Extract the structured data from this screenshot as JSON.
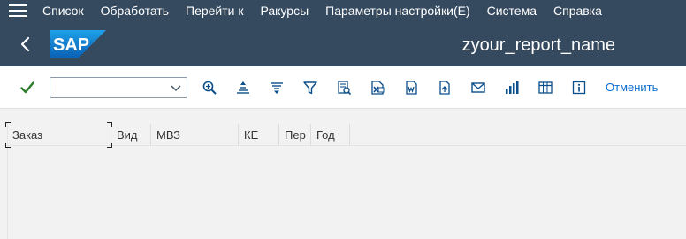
{
  "menubar": {
    "items": [
      {
        "label": "Список"
      },
      {
        "label": "Обработать"
      },
      {
        "label": "Перейти к"
      },
      {
        "label": "Ракурсы"
      },
      {
        "label": "Параметры настройки(E)"
      },
      {
        "label": "Система"
      },
      {
        "label": "Справка"
      }
    ]
  },
  "header": {
    "title": "zyour_report_name",
    "logo_text": "SAP",
    "logo_color": "#1a7fd1"
  },
  "toolbar": {
    "command_field": {
      "value": "",
      "placeholder": ""
    },
    "icons": [
      "find-icon",
      "sort-ascending-icon",
      "sort-descending-icon",
      "filter-icon",
      "details-icon",
      "spreadsheet-icon",
      "word-processing-icon",
      "local-file-icon",
      "email-icon",
      "graphic-icon",
      "change-layout-icon",
      "info-icon"
    ],
    "cancel_label": "Отменить"
  },
  "table": {
    "columns": [
      {
        "label": "Заказ"
      },
      {
        "label": "Вид"
      },
      {
        "label": "МВЗ"
      },
      {
        "label": "КЕ"
      },
      {
        "label": "Пер"
      },
      {
        "label": "Год"
      }
    ]
  },
  "colors": {
    "shell_bg": "#354a5f",
    "accent": "#0a6ed1",
    "ok_green": "#2b7d2b",
    "icon_blue": "#0a4e8c"
  }
}
